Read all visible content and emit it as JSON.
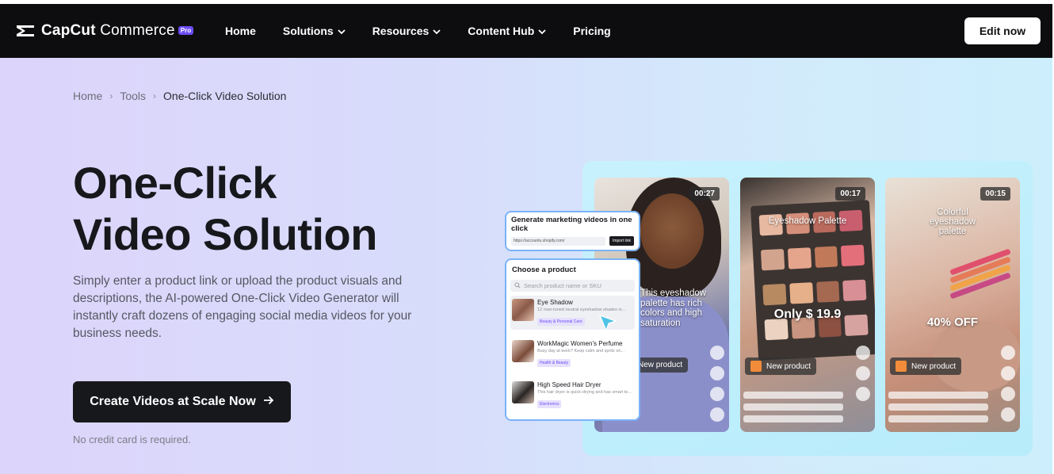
{
  "nav": {
    "brand": "CapCut",
    "brand_suffix": "Commerce",
    "pro_badge": "Pro",
    "items": [
      {
        "label": "Home",
        "has_dropdown": false
      },
      {
        "label": "Solutions",
        "has_dropdown": true
      },
      {
        "label": "Resources",
        "has_dropdown": true
      },
      {
        "label": "Content Hub",
        "has_dropdown": true
      },
      {
        "label": "Pricing",
        "has_dropdown": false
      }
    ],
    "edit_button": "Edit now"
  },
  "breadcrumb": {
    "items": [
      "Home",
      "Tools"
    ],
    "current": "One-Click Video Solution"
  },
  "hero": {
    "title_line1": "One-Click",
    "title_line2": "Video Solution",
    "description": "Simply enter a product link or upload the product visuals and descriptions, the AI-powered One-Click Video Generator will instantly craft dozens of engaging social media videos for your business needs.",
    "cta": "Create Videos at Scale Now",
    "note": "No credit card is required."
  },
  "generator_panel": {
    "title": "Generate marketing videos in one click",
    "url": "https://accountu.shopify.com/",
    "import_button": "Import link"
  },
  "product_panel": {
    "title": "Choose a product",
    "search_placeholder": "Search product name or SKU",
    "products": [
      {
        "name": "Eye Shadow",
        "desc": "12 rose-toned neutral eyeshadow shades in...",
        "tag": "Beauty & Personal Care",
        "selected": true
      },
      {
        "name": "WorkMagic Women's Perfume",
        "desc": "Busy day at work? Keep calm and spritz on...",
        "tag": "Health & Beauty",
        "selected": false
      },
      {
        "name": "High Speed Hair Dryer",
        "desc": "This hair dryer is quick-drying and has smart te...",
        "tag": "Electronics",
        "selected": false
      }
    ]
  },
  "videos": [
    {
      "duration": "00:27",
      "caption": "This eyeshadow palette has rich colors and high saturation",
      "badge": "New product"
    },
    {
      "duration": "00:17",
      "title": "Eyeshadow Palette",
      "price": "Only $ 19.9",
      "badge": "New product"
    },
    {
      "duration": "00:15",
      "title": "Colorful eyeshadow palette",
      "price": "40% OFF",
      "badge": "New product"
    }
  ],
  "colors": {
    "nav_bg": "#0d0d0f",
    "accent": "#6d4cf6",
    "cta_bg": "#17181c",
    "panel_border": "#7bb3f7"
  }
}
